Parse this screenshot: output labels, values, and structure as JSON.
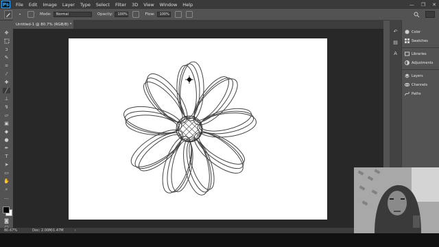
{
  "app": {
    "logo": "Ps"
  },
  "menu": [
    "File",
    "Edit",
    "Image",
    "Layer",
    "Type",
    "Select",
    "Filter",
    "3D",
    "View",
    "Window",
    "Help"
  ],
  "window_controls": [
    "—",
    "❐",
    "✕"
  ],
  "options": {
    "mode_label": "Mode:",
    "mode_value": "Normal",
    "opacity_label": "Opacity:",
    "opacity_value": "100%",
    "flow_label": "Flow:",
    "flow_value": "100%"
  },
  "document_tab": {
    "label": "Untitled-1 @ 80.7% (RGB/8) *"
  },
  "status": {
    "zoom": "80.67%",
    "doc": "Doc: 2.00M/1.47M",
    "arrow": "›"
  },
  "panels": {
    "items": [
      "Color",
      "Swatches",
      "Libraries",
      "Adjustments",
      "Layers",
      "Channels",
      "Paths"
    ]
  },
  "colors": {
    "foreground": "#000000",
    "background": "#ffffff"
  }
}
